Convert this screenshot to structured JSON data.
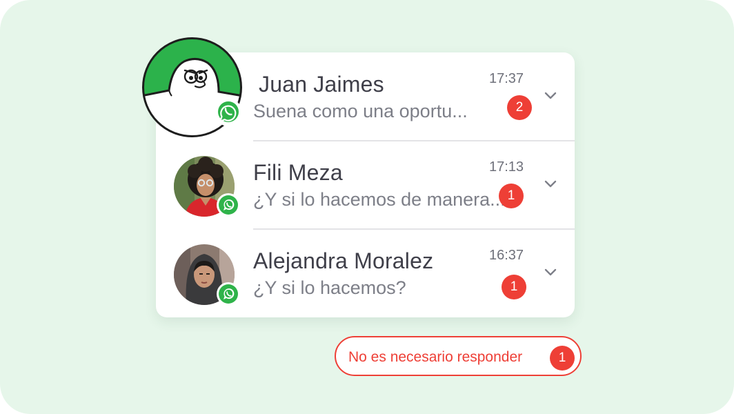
{
  "chats": [
    {
      "name": "Juan Jaimes",
      "preview": "Suena como una oportu...",
      "time": "17:37",
      "unread": "2",
      "avatar": "cartoon-mascot-avatar"
    },
    {
      "name": "Fili Meza",
      "preview": "¿Y si lo hacemos de manera...",
      "time": "17:13",
      "unread": "1",
      "avatar": "woman-curly-hair-photo"
    },
    {
      "name": "Alejandra Moralez",
      "preview": "¿Y si lo hacemos?",
      "time": "16:37",
      "unread": "1",
      "avatar": "woman-hood-photo"
    }
  ],
  "footer_chip": {
    "label": "No es necesario responder",
    "count": "1"
  },
  "icons": {
    "channel": "whatsapp-icon",
    "expand": "chevron-down-icon"
  },
  "colors": {
    "background": "#e6f6ea",
    "accent_red": "#ee3f36",
    "whatsapp_green": "#2fb34a",
    "mascot_green": "#2cb24b",
    "name_text": "#3f3f49",
    "preview_text": "#7d7f88"
  }
}
